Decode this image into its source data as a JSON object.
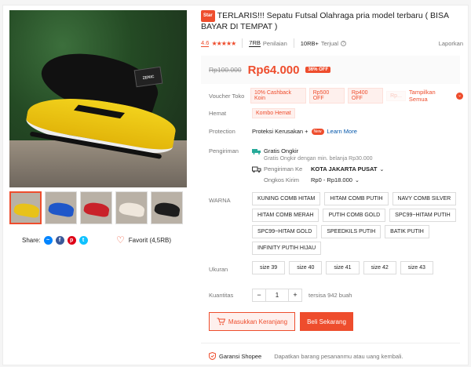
{
  "product": {
    "badge": "Star",
    "title": "TERLARIS!!! Sepatu Futsal Olahraga pria model terbaru ( BISA BAYAR DI TEMPAT )",
    "rating": "4.6",
    "stars": "★★★★★",
    "review_count": "7RB",
    "review_label": "Penilaian",
    "sold_count": "10RB+",
    "sold_label": "Terjual",
    "report": "Laporkan",
    "image_sign": "ZENIC"
  },
  "price": {
    "original": "Rp100.000",
    "current": "Rp64.000",
    "discount": "36% OFF"
  },
  "voucher": {
    "label": "Voucher Toko",
    "tags": [
      "10% Cashback Koin",
      "Rp500 OFF",
      "Rp400 OFF",
      "Rp..."
    ],
    "show_all": "Tampilkan Semua"
  },
  "hemat": {
    "label": "Hemat",
    "tag": "Kombo Hemat"
  },
  "protection": {
    "label": "Protection",
    "text": "Proteksi Kerusakan +",
    "badge": "New",
    "learn": "Learn More"
  },
  "shipping": {
    "label": "Pengiriman",
    "free_title": "Gratis Ongkir",
    "free_desc": "Gratis Ongkir dengan min. belanja Rp30.000",
    "to_label": "Pengiriman Ke",
    "to_value": "KOTA JAKARTA PUSAT",
    "cost_label": "Ongkos Kirim",
    "cost_value": "Rp0 - Rp18.000"
  },
  "colors": {
    "label": "WARNA",
    "options": [
      "KUNING COMB HITAM",
      "HITAM COMB PUTIH",
      "NAVY COMB SILVER",
      "HITAM COMB MERAH",
      "PUTIH COMB GOLD",
      "SPC99~HITAM PUTIH",
      "SPC99~HITAM GOLD",
      "SPEEDKILS PUTIH",
      "BATIK PUTIH",
      "INFINITY PUTIH HIJAU"
    ]
  },
  "sizes": {
    "label": "Ukuran",
    "options": [
      "size 39",
      "size 40",
      "size 41",
      "size 42",
      "size 43"
    ]
  },
  "quantity": {
    "label": "Kuantitas",
    "minus": "−",
    "value": "1",
    "plus": "+",
    "stock": "tersisa 942 buah"
  },
  "actions": {
    "cart": "Masukkan Keranjang",
    "buy": "Beli Sekarang"
  },
  "guarantee": {
    "title": "Garansi Shopee",
    "desc": "Dapatkan barang pesananmu atau uang kembali."
  },
  "share": {
    "label": "Share:",
    "icons": [
      "messenger-icon",
      "facebook-icon",
      "pinterest-icon",
      "twitter-icon"
    ]
  },
  "favorite": {
    "label": "Favorit (4,5RB)"
  },
  "thumbnails": [
    {
      "color": "#e8c21a",
      "name": "thumb-yellow"
    },
    {
      "color": "#1f57c9",
      "name": "thumb-blue"
    },
    {
      "color": "#c9222a",
      "name": "thumb-red"
    },
    {
      "color": "#efe7dc",
      "name": "thumb-white-gold"
    },
    {
      "color": "#1d1d1d",
      "name": "thumb-black"
    }
  ],
  "theme": {
    "accent": "#ee4d2d"
  }
}
